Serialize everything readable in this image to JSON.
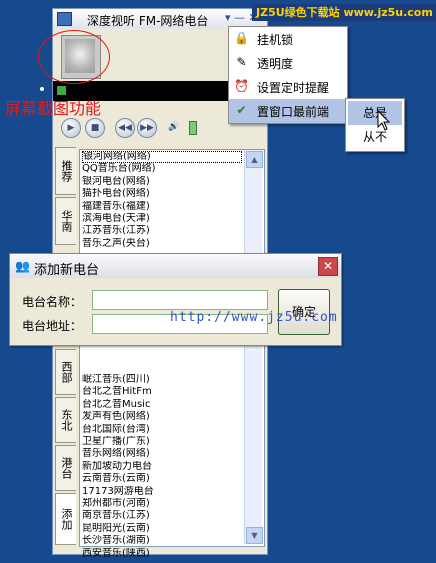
{
  "main_window": {
    "title": "深度视听 FM-网络电台",
    "title_buttons": "▾ — ✕"
  },
  "watermark": {
    "text": "JZ5U绿色下载站 www.jz5u.com"
  },
  "annotation": {
    "label": "屏幕截图功能"
  },
  "context_menu": {
    "items": [
      {
        "label": "挂机锁",
        "icon": "lock-icon",
        "glyph": "🔒"
      },
      {
        "label": "透明度",
        "icon": "wand-icon",
        "glyph": "✎"
      },
      {
        "label": "设置定时提醒",
        "icon": "alarm-clock-icon",
        "glyph": "⏰"
      },
      {
        "label": "置窗口最前端",
        "icon": "checkmark-icon",
        "glyph": "✔"
      }
    ],
    "submenu": [
      "总是",
      "从不"
    ]
  },
  "tabs": [
    "推荐",
    "华南",
    "",
    "西部",
    "东北",
    "港台",
    "添加"
  ],
  "stations": [
    "银河网络(网络)",
    "QQ音乐台(网络)",
    "银河电台(网络)",
    "猫扑电台(网络)",
    "福建音乐(福建)",
    "滨海电台(天津)",
    "江苏音乐(江苏)",
    "音乐之声(央台)",
    "",
    "",
    "",
    "",
    "",
    "",
    "",
    "",
    "",
    "",
    "岷江音乐(四川)",
    "台北之音HitFm",
    "台北之音Music",
    "发声有色(网络)",
    "台北国际(台湾)",
    "卫星广播(广东)",
    "音乐网络(网络)",
    "新加坡动力电台",
    "云南音乐(云南)",
    "17173网游电台",
    "郑州都市(河南)",
    "南京音乐(江苏)",
    "昆明阳光(云南)",
    "长沙音乐(湖南)",
    "西安音乐(陕西)"
  ],
  "player_controls": [
    "▶",
    "■",
    "◀◀",
    "▶▶",
    "🔊"
  ],
  "dialog": {
    "title": "添加新电台",
    "name_label": "电台名称：",
    "url_label": "电台地址：",
    "name_value": "",
    "url_value": "",
    "ok_label": "确定",
    "close_glyph": "✕"
  },
  "url_overlay": "http://www.jz5u.com"
}
